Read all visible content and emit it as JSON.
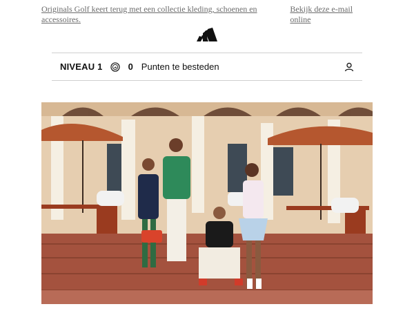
{
  "preheader": {
    "left_link": "Originals Golf keert terug met een collectie kleding, schoenen en accessoires.",
    "right_link": "Bekijk deze e-mail online"
  },
  "logo": {
    "icon": "adidas-logo"
  },
  "loyalty": {
    "level": "NIVEAU 1",
    "coin_icon": "points-coin-icon",
    "points": "0",
    "points_label": "Punten te besteden",
    "user_icon": "user-icon"
  },
  "hero": {
    "description": "hero-photo-golf-group",
    "colors": {
      "sky_wall": "#e8d2b2",
      "umbrella": "#b45a36",
      "brick": "#a6533f",
      "column": "#f3ede2"
    }
  }
}
